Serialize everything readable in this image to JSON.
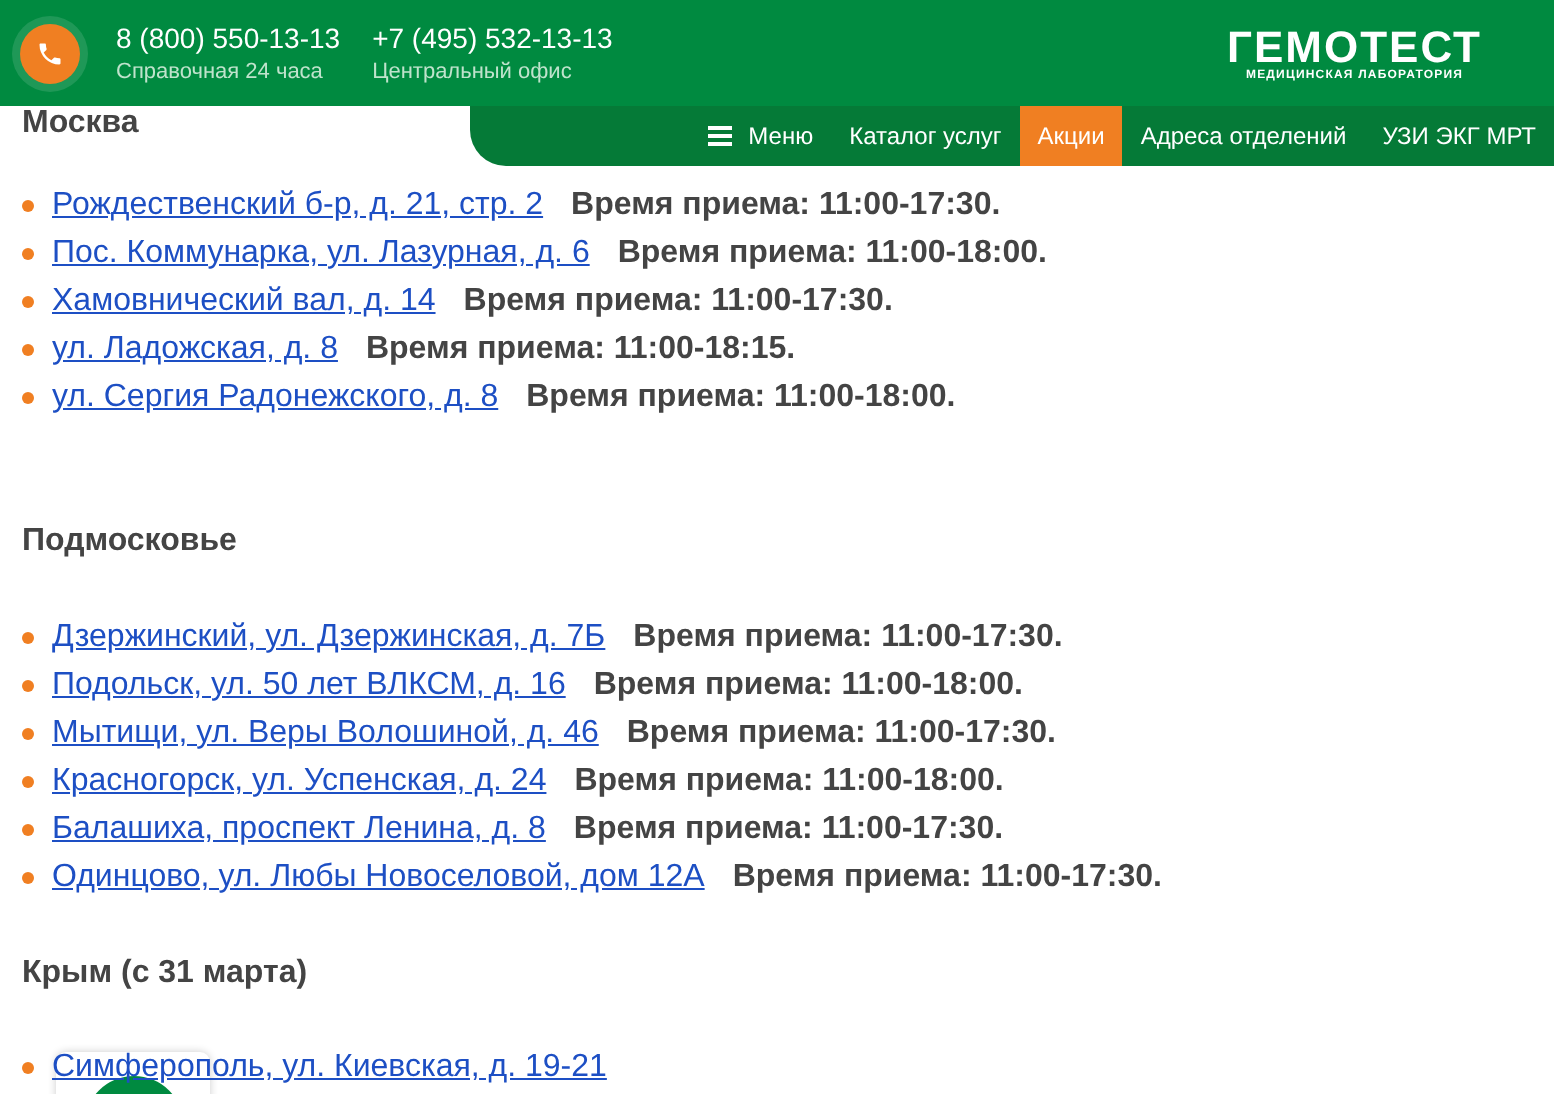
{
  "header": {
    "phones": [
      {
        "number": "8 (800) 550-13-13",
        "caption": "Справочная 24 часа"
      },
      {
        "number": "+7 (495) 532-13-13",
        "caption": "Центральный офис"
      }
    ],
    "logo": {
      "name": "ГЕМОТЕСТ",
      "tagline": "МЕДИЦИНСКАЯ ЛАБОРАТОРИЯ"
    }
  },
  "nav": [
    {
      "label": "Меню",
      "kind": "menu",
      "selected": false
    },
    {
      "label": "Каталог услуг",
      "kind": "link",
      "selected": false
    },
    {
      "label": "Акции",
      "kind": "link",
      "selected": true
    },
    {
      "label": "Адреса отделений",
      "kind": "link",
      "selected": false
    },
    {
      "label": "УЗИ ЭКГ МРТ",
      "kind": "link",
      "selected": false
    }
  ],
  "sections": [
    {
      "title": "Москва",
      "items": [
        {
          "address": "Рождественский б-р, д. 21, стр. 2",
          "hours": "Время приема: 11:00-17:30."
        },
        {
          "address": "Пос. Коммунарка, ул. Лазурная, д. 6",
          "hours": "Время приема: 11:00-18:00."
        },
        {
          "address": "Хамовнический вал, д. 14",
          "hours": "Время приема: 11:00-17:30."
        },
        {
          "address": "ул. Ладожская, д. 8",
          "hours": "Время приема: 11:00-18:15."
        },
        {
          "address": "ул. Сергия Радонежского, д. 8",
          "hours": "Время приема: 11:00-18:00."
        }
      ]
    },
    {
      "title": "Подмосковье",
      "items": [
        {
          "address": "Дзержинский, ул. Дзержинская, д. 7Б",
          "hours": "Время приема: 11:00-17:30."
        },
        {
          "address": "Подольск, ул. 50 лет ВЛКСМ, д. 16",
          "hours": "Время приема: 11:00-18:00."
        },
        {
          "address": "Мытищи, ул. Веры Волошиной, д. 46",
          "hours": "Время приема: 11:00-17:30."
        },
        {
          "address": "Красногорск, ул. Успенская, д. 24",
          "hours": "Время приема: 11:00-18:00."
        },
        {
          "address": "Балашиха, проспект Ленина, д. 8",
          "hours": "Время приема: 11:00-17:30."
        },
        {
          "address": "Одинцово, ул. Любы Новоселовой, дом 12А",
          "hours": "Время приема: 11:00-17:30."
        }
      ]
    },
    {
      "title": "Крым (с 31 марта)",
      "items": [
        {
          "address": "Симферополь, ул. Киевская, д. 19-21"
        }
      ]
    }
  ]
}
